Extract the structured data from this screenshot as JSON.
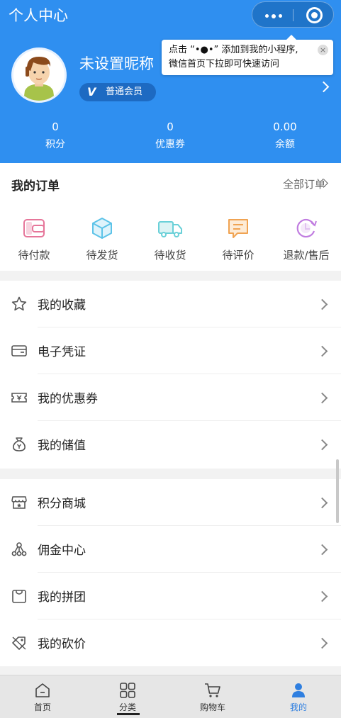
{
  "header": {
    "title": "个人中心",
    "capsule": {
      "more_icon": "more-dots-icon",
      "close_icon": "miniapp-close-icon"
    },
    "tip": {
      "line1": "点击 “•●•” 添加到我的小程序,",
      "line2": "微信首页下拉即可快速访问",
      "close": "×"
    },
    "profile": {
      "nickname": "未设置昵称",
      "member_level_icon": "V",
      "member_level": "普通会员"
    },
    "stats": [
      {
        "value": "0",
        "label": "积分"
      },
      {
        "value": "0",
        "label": "优惠券"
      },
      {
        "value": "0.00",
        "label": "余额"
      }
    ],
    "colors": {
      "primary": "#2f8ff0"
    }
  },
  "orders": {
    "title": "我的订单",
    "all_label": "全部订单",
    "items": [
      {
        "label": "待付款",
        "icon": "wallet-icon",
        "color": "#e6769a"
      },
      {
        "label": "待发货",
        "icon": "package-icon",
        "color": "#5cc3e8"
      },
      {
        "label": "待收货",
        "icon": "truck-icon",
        "color": "#6ad0d8"
      },
      {
        "label": "待评价",
        "icon": "comment-icon",
        "color": "#f0a352"
      },
      {
        "label": "退款/售后",
        "icon": "refund-clock-icon",
        "color": "#c07ce0"
      }
    ]
  },
  "menu1": [
    {
      "label": "我的收藏",
      "icon": "star-icon"
    },
    {
      "label": "电子凭证",
      "icon": "card-icon"
    },
    {
      "label": "我的优惠券",
      "icon": "coupon-icon"
    },
    {
      "label": "我的储值",
      "icon": "money-bag-icon"
    }
  ],
  "menu2": [
    {
      "label": "积分商城",
      "icon": "store-icon"
    },
    {
      "label": "佣金中心",
      "icon": "network-icon"
    },
    {
      "label": "我的拼团",
      "icon": "group-bag-icon"
    },
    {
      "label": "我的砍价",
      "icon": "bargain-tag-icon"
    }
  ],
  "tabbar": [
    {
      "label": "首页",
      "icon": "home-icon"
    },
    {
      "label": "分类",
      "icon": "grid-icon"
    },
    {
      "label": "购物车",
      "icon": "cart-icon"
    },
    {
      "label": "我的",
      "icon": "user-icon",
      "active": true
    }
  ]
}
